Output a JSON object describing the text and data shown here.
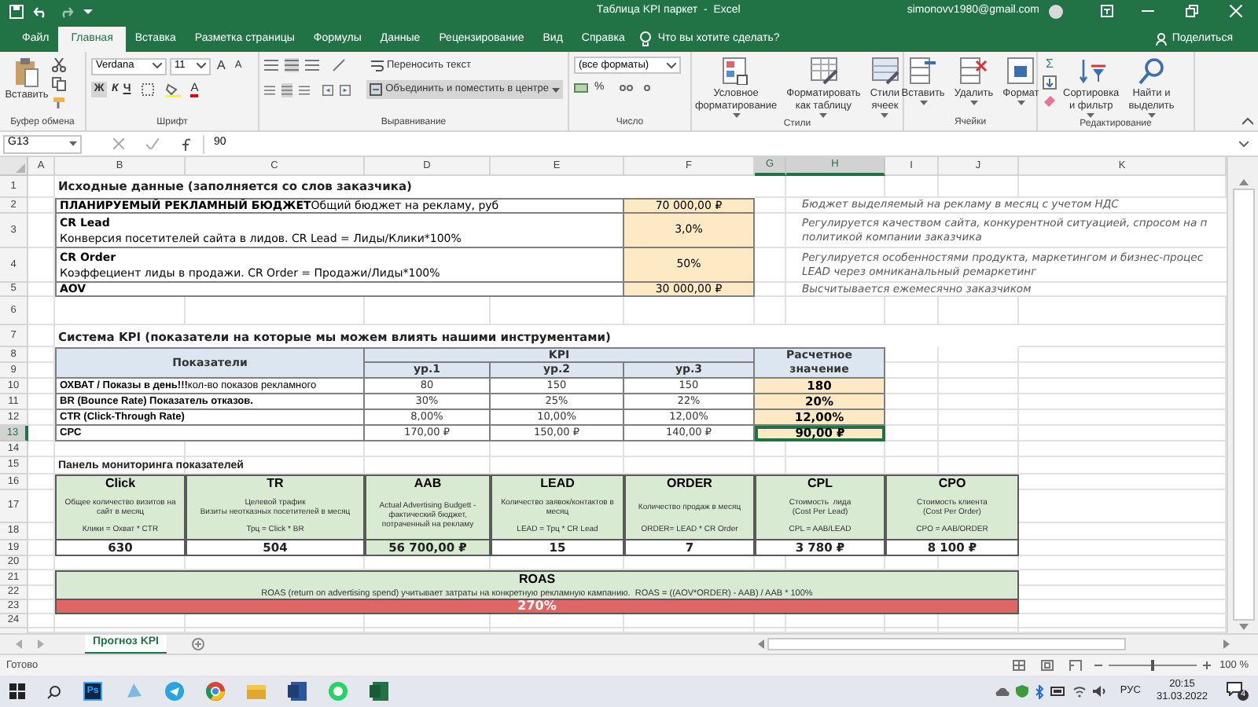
{
  "title_bar": {
    "title": "Таблица KPI паркет  -  Excel",
    "account": "simonovv1980@gmail.com"
  },
  "ribbon_tabs": [
    {
      "label": "Файл",
      "selected": false
    },
    {
      "label": "Главная",
      "selected": true
    },
    {
      "label": "Вставка",
      "selected": false
    },
    {
      "label": "Разметка страницы",
      "selected": false
    },
    {
      "label": "Формулы",
      "selected": false
    },
    {
      "label": "Данные",
      "selected": false
    },
    {
      "label": "Рецензирование",
      "selected": false
    },
    {
      "label": "Вид",
      "selected": false
    },
    {
      "label": "Справка",
      "selected": false
    }
  ],
  "tell_me": "Что вы хотите сделать?",
  "share": "Поделиться",
  "ribbon": {
    "clipboard": {
      "paste": "Вставить",
      "label": "Буфер обмена"
    },
    "font": {
      "name": "Verdana",
      "size": "11",
      "grow": "A",
      "shrink": "A",
      "bold": "Ж",
      "italic": "К",
      "underline": "Ч",
      "font_color_letter": "A",
      "label": "Шрифт"
    },
    "alignment": {
      "wrap": "Переносить текст",
      "merge": "Объединить и поместить в центре",
      "label": "Выравнивание"
    },
    "number": {
      "format": "(все форматы)",
      "percent": "%",
      "label": "Число"
    },
    "styles": {
      "buttons": [
        {
          "lines": [
            "Условное",
            "форматирование"
          ]
        },
        {
          "lines": [
            "Форматировать",
            "как таблицу"
          ]
        },
        {
          "lines": [
            "Стили",
            "ячеек"
          ]
        }
      ],
      "label": "Стили"
    },
    "cells": {
      "buttons": [
        {
          "lines": [
            "Вставить"
          ]
        },
        {
          "lines": [
            "Удалить"
          ]
        },
        {
          "lines": [
            "Формат"
          ]
        }
      ],
      "label": "Ячейки"
    },
    "editing": {
      "autosum": "Σ",
      "buttons": [
        {
          "lines": [
            "Сортировка",
            "и фильтр"
          ]
        },
        {
          "lines": [
            "Найти и",
            "выделить"
          ]
        }
      ],
      "label": "Редактирование"
    }
  },
  "formula_bar": {
    "name_box": "G13",
    "formula": "90"
  },
  "columns": [
    {
      "label": "A",
      "selected": false
    },
    {
      "label": "B",
      "selected": false
    },
    {
      "label": "C",
      "selected": false
    },
    {
      "label": "D",
      "selected": false
    },
    {
      "label": "E",
      "selected": false
    },
    {
      "label": "F",
      "selected": false
    },
    {
      "label": "G",
      "selected": true
    },
    {
      "label": "H",
      "selected": true
    },
    {
      "label": "I",
      "selected": false
    },
    {
      "label": "J",
      "selected": false
    },
    {
      "label": "K",
      "selected": false
    }
  ],
  "rows": [
    {
      "label": "1",
      "selected": false
    },
    {
      "label": "2",
      "selected": false
    },
    {
      "label": "3",
      "selected": false
    },
    {
      "label": "4",
      "selected": false
    },
    {
      "label": "5",
      "selected": false
    },
    {
      "label": "6",
      "selected": false
    },
    {
      "label": "7",
      "selected": false
    },
    {
      "label": "8",
      "selected": false
    },
    {
      "label": "9",
      "selected": false
    },
    {
      "label": "10",
      "selected": false
    },
    {
      "label": "11",
      "selected": false
    },
    {
      "label": "12",
      "selected": false
    },
    {
      "label": "13",
      "selected": true
    },
    {
      "label": "14",
      "selected": false
    },
    {
      "label": "15",
      "selected": false
    },
    {
      "label": "16",
      "selected": false
    },
    {
      "label": "17",
      "selected": false
    },
    {
      "label": "18",
      "selected": false
    },
    {
      "label": "19",
      "selected": false
    },
    {
      "label": "20",
      "selected": false
    },
    {
      "label": "21",
      "selected": false
    },
    {
      "label": "22",
      "selected": false
    },
    {
      "label": "23",
      "selected": false
    },
    {
      "label": "24",
      "selected": false
    }
  ],
  "source_data": {
    "title": "Исходные данные (заполняется со слов заказчика)",
    "rows": [
      {
        "kind": "inline",
        "name": "ПЛАНИРУЕМЫЙ РЕКЛАМНЫЙ БЮДЖЕТ",
        "description": "Общий бюджет на рекламу, руб",
        "value": "70 000,00 ₽",
        "note_lines": [
          "Бюджет выделяемый на рекламу в месяц с учетом НДС"
        ]
      },
      {
        "kind": "stacked",
        "name": "CR Lead",
        "description": "Конверсия посетителей сайта в лидов. CR Lead = Лиды/Клики*100%",
        "value": "3,0%",
        "note_lines": [
          "Регулируется качеством сайта, конкурентной ситуацией, спросом на п",
          "политикой компании заказчика"
        ]
      },
      {
        "kind": "stacked",
        "name": "CR Order",
        "description": "Коэффециент лиды в продажи. CR Order = Продажи/Лиды*100%",
        "value": "50%",
        "note_lines": [
          "Регулируется особенностями продукта, маркетингом и бизнес-процес",
          "LEAD через омниканальный ремаркетинг"
        ]
      },
      {
        "kind": "inline",
        "name": "AOV",
        "value": "30 000,00 ₽",
        "note_lines": [
          "Высчитывается ежемесячно заказчиком"
        ]
      }
    ]
  },
  "kpi": {
    "title": "Система KPI  (показатели на которые мы можем влиять нашими инструментами)",
    "header": {
      "indicator": "Показатели",
      "group": "KPI",
      "levels": [
        "ур.1",
        "ур.2",
        "ур.3"
      ],
      "result": "Расчетное значение"
    },
    "rows": [
      {
        "label": "ОХВАТ / Показы в день!!!",
        "detail": "кол-во показов рекламного",
        "values": [
          "80",
          "150",
          "150"
        ],
        "result": "180",
        "selected": false
      },
      {
        "label": "BR (Bounce Rate) Показатель отказов.",
        "values": [
          "30%",
          "25%",
          "22%"
        ],
        "result": "20%",
        "selected": false
      },
      {
        "label": "CTR (Click-Through Rate)",
        "values": [
          "8,00%",
          "10,00%",
          "12,00%"
        ],
        "result": "12,00%",
        "selected": false
      },
      {
        "label": "CPC",
        "values": [
          "170,00 ₽",
          "150,00 ₽",
          "140,00 ₽"
        ],
        "result": "90,00 ₽",
        "selected": true
      }
    ]
  },
  "monitoring": {
    "title": "Панель мониторинга показателей",
    "metrics": [
      {
        "name": "Click",
        "description_lines": [
          "Общее количество визитов на",
          "сайт в месяц"
        ],
        "formula": "Клики = Охват * CTR",
        "value": "630",
        "highlighted": false
      },
      {
        "name": "TR",
        "description_lines": [
          "Целевой трафик",
          "Визиты неотказных посетителей в месяц"
        ],
        "formula": "Трц = Click * BR",
        "value": "504",
        "highlighted": false
      },
      {
        "name": "AAB",
        "description_lines": [
          "Actual Advertising Budgett -",
          "фактический бюджет,",
          "потраченный на рекламу"
        ],
        "value": "56 700,00 ₽",
        "highlighted": true
      },
      {
        "name": "LEAD",
        "description_lines": [
          "Количество заявок/контактов в",
          "месяц"
        ],
        "formula": "LEAD = Трц * CR Lead",
        "value": "15",
        "highlighted": false
      },
      {
        "name": "ORDER",
        "description_lines": [
          "Количество продаж в месяц"
        ],
        "formula": "ORDER= LEAD * CR Order",
        "value": "7",
        "highlighted": false
      },
      {
        "name": "CPL",
        "description_lines": [
          "Стоимость  лида",
          "(Cost Per Lead)"
        ],
        "formula": "CPL = AAB/LEAD",
        "value": "3 780 ₽",
        "highlighted": false
      },
      {
        "name": "CPO",
        "description_lines": [
          "Стоимость клиента",
          "(Cost Per Order)"
        ],
        "formula": "CPO = AAB/ORDER",
        "value": "8 100 ₽",
        "highlighted": false
      }
    ]
  },
  "roas": {
    "title": "ROAS",
    "description": "ROAS (return on advertising spend) учитывает затраты на конкретную рекламную кампанию.  ROAS = ((AOV*ORDER) - AAB) / AAB * 100%",
    "value": "270%"
  },
  "sheet_tabs": [
    {
      "label": "Прогноз KPI",
      "selected": true
    }
  ],
  "status": "Готово",
  "zoom": {
    "label": "100 %",
    "level": 0.5
  },
  "taskbar": {
    "ps_label": "Ps",
    "language": "РУС",
    "time": "20:15",
    "date": "31.03.2022",
    "notifications": "4"
  }
}
